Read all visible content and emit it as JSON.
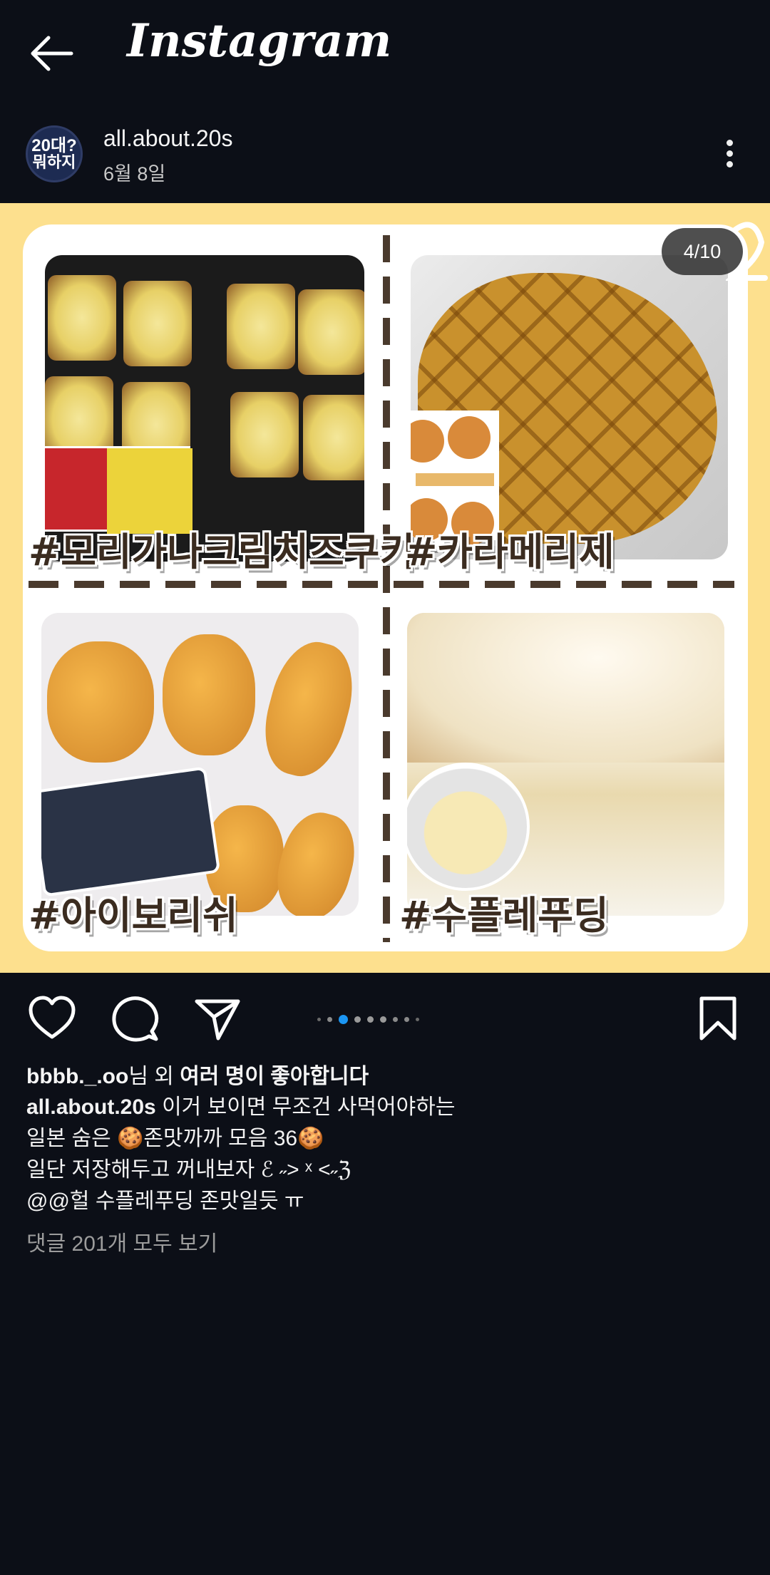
{
  "app": {
    "title": "Instagram"
  },
  "icons": {
    "back": "arrow-left-icon",
    "more": "vertical-ellipsis-icon",
    "like": "heart-icon",
    "comment": "speech-bubble-icon",
    "share": "paper-plane-icon",
    "save": "bookmark-icon"
  },
  "colors": {
    "background": "#0c0f17",
    "media_bg": "#fde08e",
    "active_dot": "#1b96f3",
    "tag_text": "#3b2c20",
    "muted_text": "#9c9c9c"
  },
  "post": {
    "username": "all.about.20s",
    "date": "6월 8일",
    "avatar": {
      "line1": "20대?",
      "line2": "뭐하지"
    },
    "media": {
      "counter": "4/10",
      "current_index": 4,
      "total": 10,
      "tags": [
        "#모리가나크림치즈쿠키",
        "#카라메리제",
        "#아이보리쉬",
        "#수플레푸딩"
      ]
    },
    "likes": {
      "user": "bbbb._.oo",
      "suffix": "님 외 ",
      "others": "여러 명이 좋아합니다"
    },
    "caption": {
      "user": "all.about.20s",
      "line1": " 이거 보이면 무조건 사먹어야하는",
      "line2": "일본 숨은 🍪존맛까까 모음 36🍪",
      "line3": "일단 저장해두고 꺼내보자 ℰ ˶> ˣ <˶ℨ",
      "line4": "@@헐 수플레푸딩 존맛일듯 ㅠ"
    },
    "view_comments": "댓글 201개 모두 보기"
  }
}
